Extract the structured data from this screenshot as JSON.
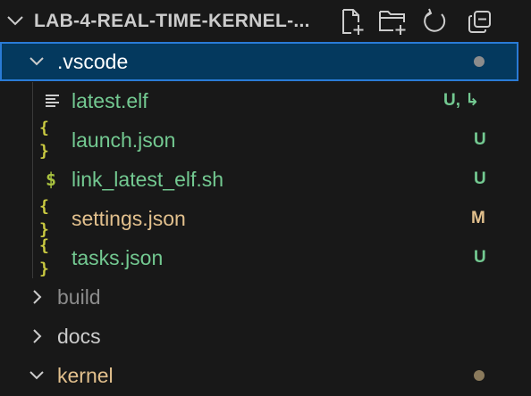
{
  "explorer": {
    "section_title": "LAB-4-REAL-TIME-KERNEL-...",
    "actions": [
      {
        "name": "new-file",
        "icon": "new-file-icon"
      },
      {
        "name": "new-folder",
        "icon": "new-folder-icon"
      },
      {
        "name": "refresh",
        "icon": "refresh-icon"
      },
      {
        "name": "collapse-all",
        "icon": "collapse-all-icon"
      }
    ],
    "tree": [
      {
        "label": ".vscode",
        "type": "folder",
        "expanded": true,
        "selected": true,
        "status_dot_color": "#8c8c8c"
      },
      {
        "label": "latest.elf",
        "type": "file",
        "icon": "lines-icon",
        "badge": "U, ↳",
        "status": "untracked-symlink"
      },
      {
        "label": "launch.json",
        "type": "file",
        "icon": "braces-icon",
        "icon_glyph": "{ }",
        "badge": "U",
        "status": "untracked"
      },
      {
        "label": "link_latest_elf.sh",
        "type": "file",
        "icon": "shell-icon",
        "icon_glyph": "$",
        "badge": "U",
        "status": "untracked"
      },
      {
        "label": "settings.json",
        "type": "file",
        "icon": "braces-icon",
        "icon_glyph": "{ }",
        "badge": "M",
        "status": "modified"
      },
      {
        "label": "tasks.json",
        "type": "file",
        "icon": "braces-icon",
        "icon_glyph": "{ }",
        "badge": "U",
        "status": "untracked"
      },
      {
        "label": "build",
        "type": "folder",
        "expanded": false,
        "status": "ignored"
      },
      {
        "label": "docs",
        "type": "folder",
        "expanded": false
      },
      {
        "label": "kernel",
        "type": "folder",
        "expanded": true,
        "status": "modified",
        "status_dot_color": "#8a7a5c"
      }
    ]
  },
  "colors": {
    "background": "#181818",
    "selected_bg": "#04395e",
    "selected_border": "#2a7bd6",
    "untracked": "#73c991",
    "modified": "#e2c08d",
    "ignored": "#8c8c8c",
    "default_text": "#cccccc",
    "json_icon": "#cbcb41"
  }
}
